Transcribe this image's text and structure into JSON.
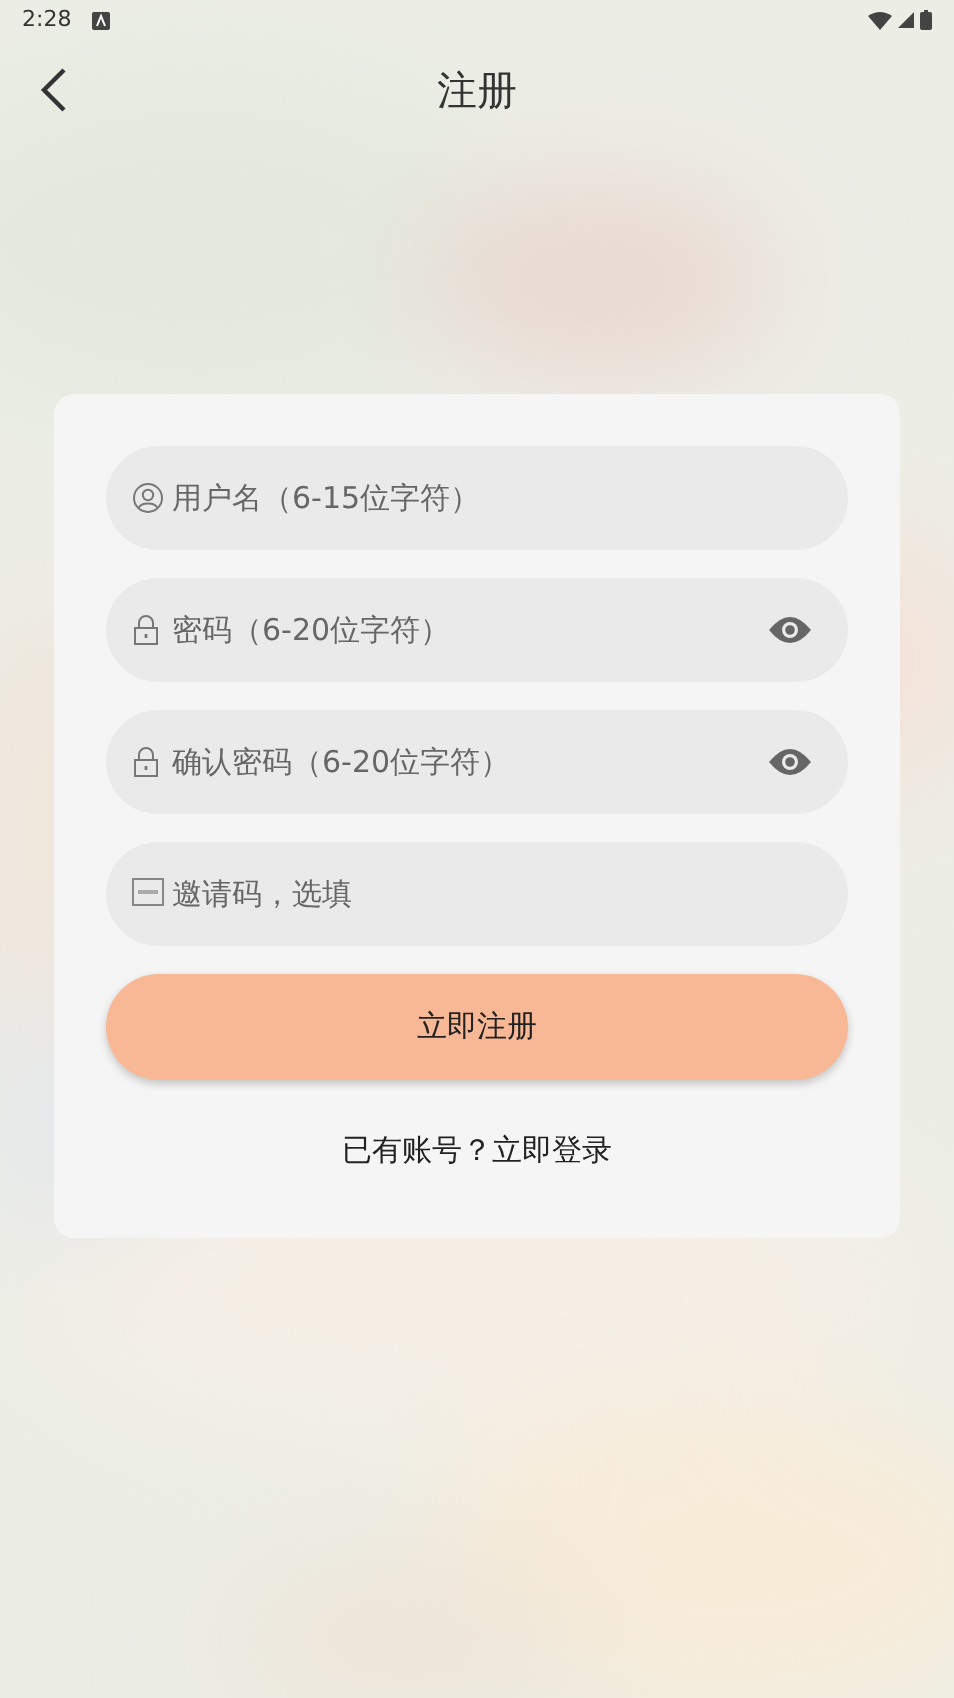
{
  "status_bar": {
    "time": "2:28"
  },
  "header": {
    "title": "注册"
  },
  "fields": [
    {
      "kind": "user",
      "placeholder": "用户名（6-15位字符）",
      "show_toggle": false
    },
    {
      "kind": "lock",
      "placeholder": "密码（6-20位字符）",
      "show_toggle": true
    },
    {
      "kind": "lock",
      "placeholder": "确认密码（6-20位字符）",
      "show_toggle": true
    },
    {
      "kind": "abc",
      "placeholder": "邀请码，选填",
      "show_toggle": false
    }
  ],
  "submit_button": "立即注册",
  "login_link": "已有账号？立即登录"
}
